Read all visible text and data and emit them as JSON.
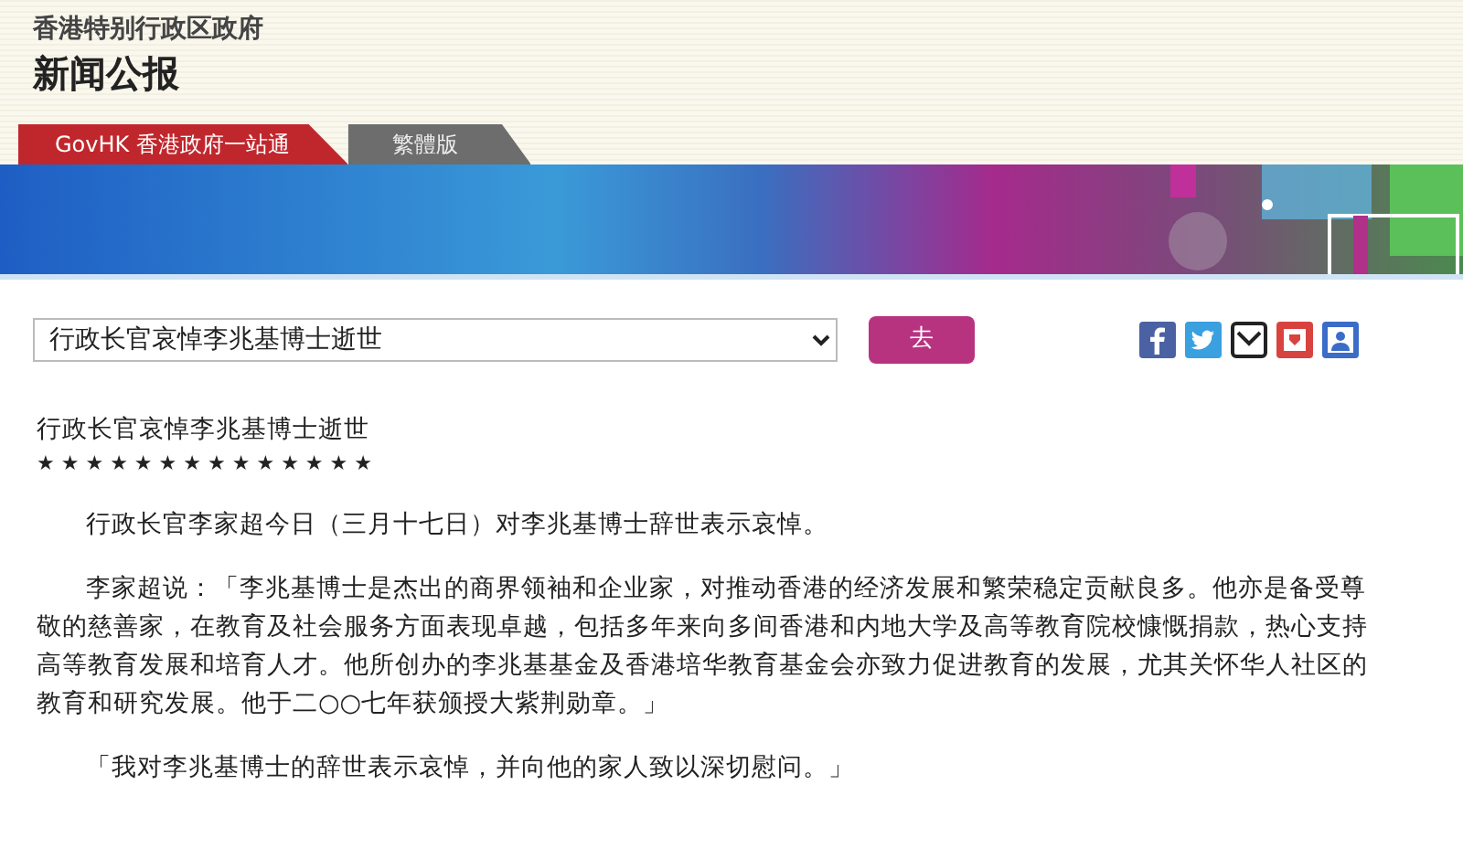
{
  "header": {
    "agency": "香港特别行政区政府",
    "title": "新闻公报"
  },
  "tabs": [
    {
      "label": "GovHK 香港政府一站通",
      "kind": "portal"
    },
    {
      "label": "繁體版",
      "kind": "language"
    }
  ],
  "article_select": {
    "value": "行政长官哀悼李兆基博士逝世",
    "button": "去"
  },
  "article": {
    "title": "行政长官哀悼李兆基博士逝世",
    "stars": "★ ★ ★ ★ ★ ★ ★ ★ ★ ★ ★ ★ ★ ★",
    "paragraphs": [
      "行政长官李家超今日（三月十七日）对李兆基博士辞世表示哀悼。",
      "李家超说：「李兆基博士是杰出的商界领袖和企业家，对推动香港的经济发展和繁荣稳定贡献良多。他亦是备受尊敬的慈善家，在教育及社会服务方面表现卓越，包括多年来向多间香港和内地大学及高等教育院校慷慨捐款，热心支持高等教育发展和培育人才。他所创办的李兆基基金及香港培华教育基金会亦致力促进教育的发展，尤其关怀华人社区的教育和研究发展。他于二○○七年获颁授大紫荆勋章。」",
      "「我对李兆基博士的辞世表示哀悼，并向他的家人致以深切慰问。」"
    ]
  }
}
